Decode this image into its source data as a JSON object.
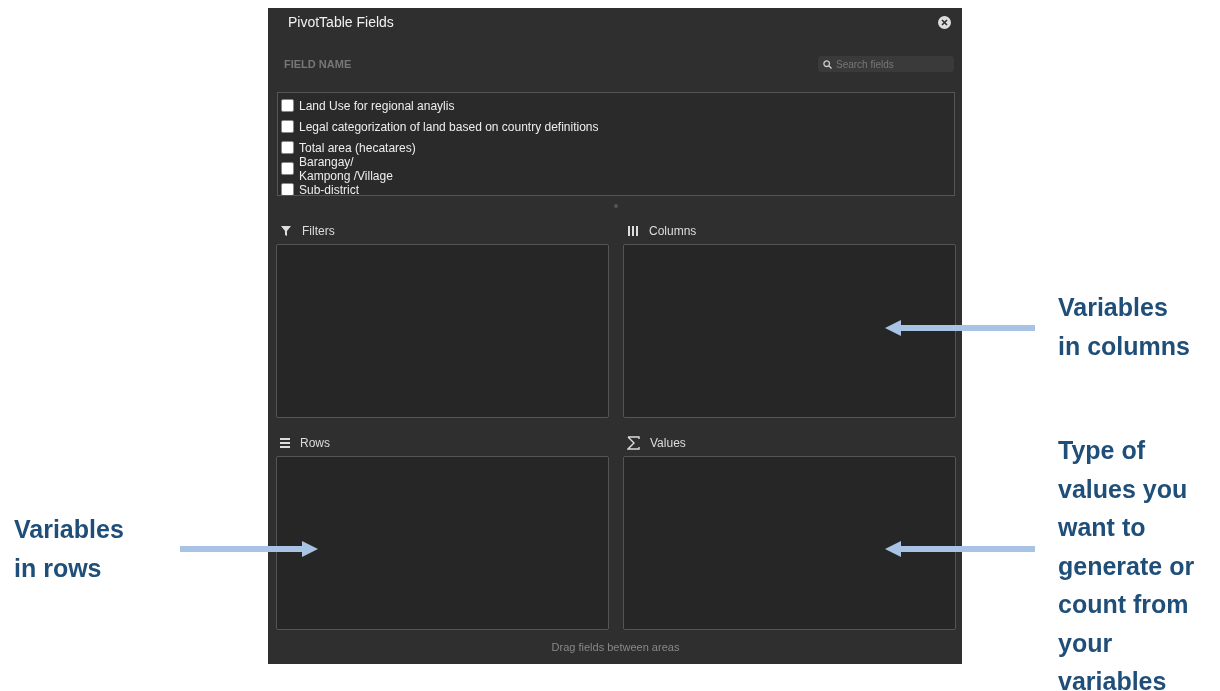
{
  "pane": {
    "title": "PivotTable Fields",
    "field_header": "FIELD NAME",
    "search": {
      "placeholder": "Search fields"
    },
    "fields": [
      {
        "label": "Land Use for regional anaylis",
        "checked": false
      },
      {
        "label": "Legal categorization of land based on country definitions",
        "checked": false
      },
      {
        "label": "Total area (hecatares)",
        "checked": false
      },
      {
        "label": "Barangay/\nKampong /Village",
        "checked": false
      },
      {
        "label": "Sub-district",
        "checked": false
      }
    ],
    "areas": [
      {
        "kind": "filters",
        "label": "Filters"
      },
      {
        "kind": "columns",
        "label": "Columns"
      },
      {
        "kind": "rows",
        "label": "Rows"
      },
      {
        "kind": "values",
        "label": "Values"
      }
    ],
    "footer": "Drag fields between areas"
  },
  "annotations": [
    {
      "text": "Variables\nin columns",
      "kind": "columns"
    },
    {
      "text": "Variables\nin rows",
      "kind": "rows"
    },
    {
      "text": "Type of\nvalues you\nwant to\ngenerate or\ncount from\nyour\nvariables",
      "kind": "values"
    }
  ]
}
